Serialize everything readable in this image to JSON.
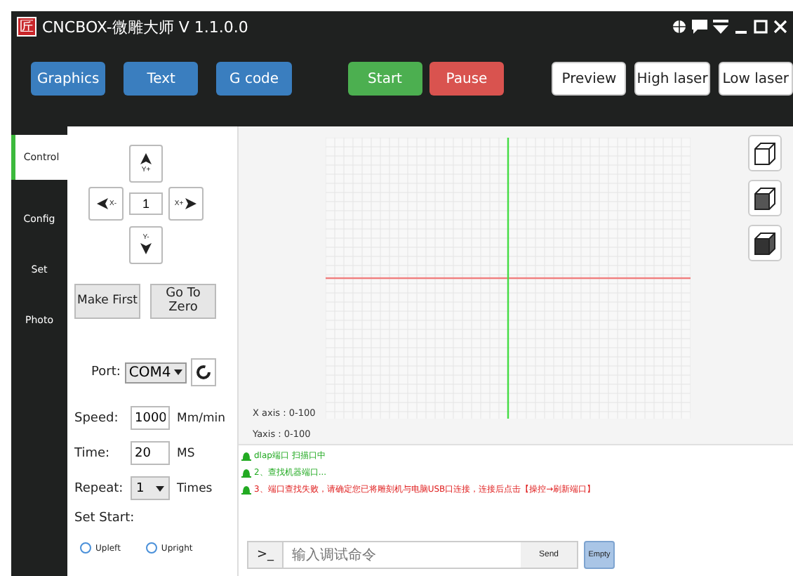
{
  "window": {
    "title": "CNCBOX-微雕大师 V 1.1.0.0",
    "logo": "匠"
  },
  "toolbar": {
    "buttons": [
      {
        "label": "Graphics",
        "kind": "blue"
      },
      {
        "label": "Text",
        "kind": "blue"
      },
      {
        "label": "G code",
        "kind": "blue"
      },
      {
        "label": "Start",
        "kind": "green"
      },
      {
        "label": "Pause",
        "kind": "red"
      },
      {
        "label": "Preview",
        "kind": "white"
      },
      {
        "label": "High laser",
        "kind": "white"
      },
      {
        "label": "Low laser",
        "kind": "white"
      }
    ]
  },
  "tabs": [
    {
      "label": "Control",
      "selected": true
    },
    {
      "label": "Config",
      "selected": false
    },
    {
      "label": "Set",
      "selected": false
    },
    {
      "label": "Photo",
      "selected": false
    }
  ],
  "jog": {
    "up": "Y+",
    "left": "X-",
    "right": "X+",
    "down": "Y-",
    "step": "1"
  },
  "actions": [
    "Make First",
    "Go To Zero"
  ],
  "port": {
    "label": "Port:",
    "value": "COM4"
  },
  "settings": [
    {
      "label": "Speed:",
      "value": "1000",
      "unit": "Mm/min",
      "kind": "input"
    },
    {
      "label": "Time:",
      "value": "20",
      "unit": "MS",
      "kind": "input"
    },
    {
      "label": "Repeat:",
      "value": "1",
      "unit": "Times",
      "kind": "select"
    }
  ],
  "set_start": {
    "label": "Set Start:",
    "options": [
      {
        "label": "Upleft",
        "selected": false
      },
      {
        "label": "Upright",
        "selected": false
      }
    ]
  },
  "axes": [
    "X axis : 0-100",
    "Yaxis : 0-100"
  ],
  "log": [
    {
      "text": "dlap端口 扫描口中",
      "color": "#22aa22"
    },
    {
      "text": "2、查找机器端口...",
      "color": "#22aa22"
    },
    {
      "text": "3、端口查找失败，请确定您已将雕刻机与电脑USB口连接，连接后点击【操控→刷新端口】",
      "color": "#e02020"
    }
  ],
  "console": {
    "prompt": ">_",
    "placeholder": "输入调试命令",
    "send": "Send",
    "empty": "Empty"
  }
}
